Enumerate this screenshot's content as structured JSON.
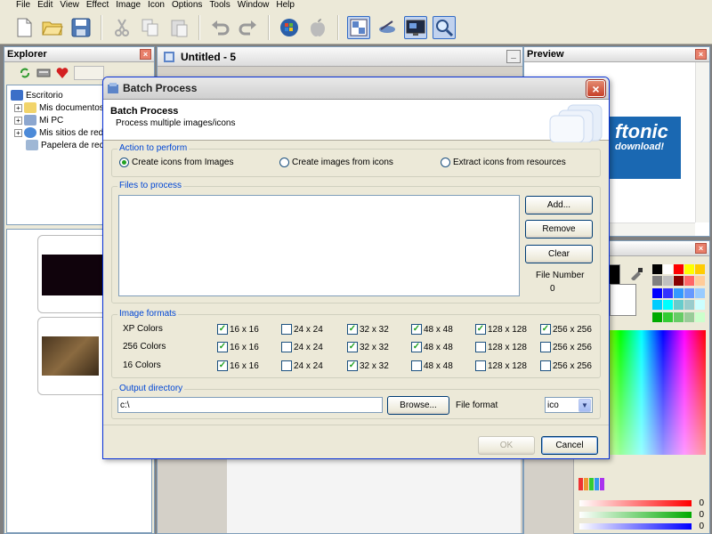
{
  "menu": [
    "File",
    "Edit",
    "View",
    "Effect",
    "Image",
    "Icon",
    "Options",
    "Tools",
    "Window",
    "Help"
  ],
  "explorer": {
    "title": "Explorer",
    "close": "×",
    "tree": [
      {
        "label": "Escritorio"
      },
      {
        "label": "Mis documentos"
      },
      {
        "label": "Mi PC"
      },
      {
        "label": "Mis sitios de red"
      },
      {
        "label": "Papelera de reci"
      }
    ]
  },
  "editor": {
    "title": "Untitled - 5",
    "minimize": "_"
  },
  "preview": {
    "title": "Preview",
    "close": "×",
    "brand_big": "ftonic",
    "brand_small": "download!"
  },
  "colors": {
    "slider_values": [
      "0",
      "0",
      "0"
    ]
  },
  "dialog": {
    "title": "Batch Process",
    "close": "×",
    "header_title": "Batch Process",
    "header_subtitle": "Process multiple images/icons",
    "action_group": "Action to perform",
    "actions": [
      {
        "label": "Create icons from Images",
        "selected": true
      },
      {
        "label": "Create images from icons",
        "selected": false
      },
      {
        "label": "Extract icons from resources",
        "selected": false
      }
    ],
    "files_group": "Files to process",
    "add_button": "Add...",
    "remove_button": "Remove",
    "clear_button": "Clear",
    "file_number_label": "File Number",
    "file_number_value": "0",
    "formats_group": "Image formats",
    "format_rows": [
      {
        "label": "XP Colors",
        "checks": [
          true,
          false,
          true,
          true,
          true,
          true
        ]
      },
      {
        "label": "256 Colors",
        "checks": [
          true,
          false,
          true,
          true,
          false,
          false
        ]
      },
      {
        "label": "16 Colors",
        "checks": [
          true,
          false,
          true,
          false,
          false,
          false
        ]
      }
    ],
    "sizes": [
      "16 x 16",
      "24 x 24",
      "32 x 32",
      "48 x 48",
      "128 x 128",
      "256 x 256"
    ],
    "output_group": "Output directory",
    "output_value": "c:\\",
    "browse_button": "Browse...",
    "file_format_label": "File format",
    "file_format_value": "ico",
    "ok_button": "OK",
    "cancel_button": "Cancel"
  }
}
